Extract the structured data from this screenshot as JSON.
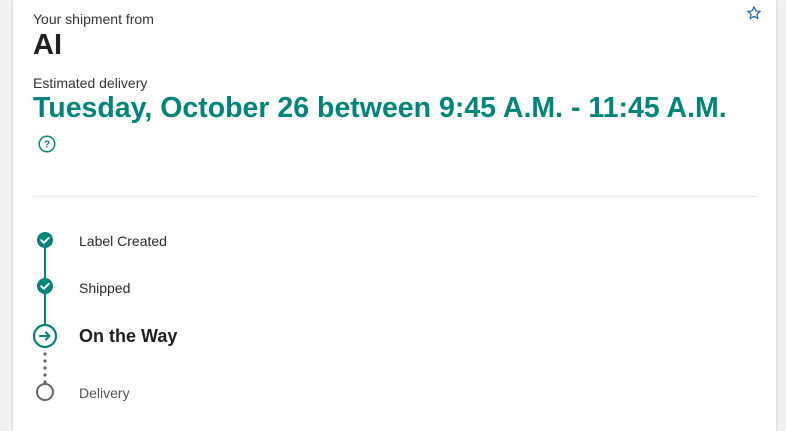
{
  "shipment": {
    "from_label": "Your shipment from",
    "shipper": "AI",
    "estimated_label": "Estimated delivery",
    "estimated_value": "Tuesday, October 26 between 9:45 A.M. - 11:45 A.M."
  },
  "icons": {
    "favorite": "star-outline-icon",
    "help": "question-circle-icon"
  },
  "colors": {
    "accent": "#00857a",
    "pending": "#666666"
  },
  "timeline": [
    {
      "label": "Label Created",
      "status": "complete"
    },
    {
      "label": "Shipped",
      "status": "complete"
    },
    {
      "label": "On the Way",
      "status": "current"
    },
    {
      "label": "Delivery",
      "status": "pending"
    }
  ]
}
